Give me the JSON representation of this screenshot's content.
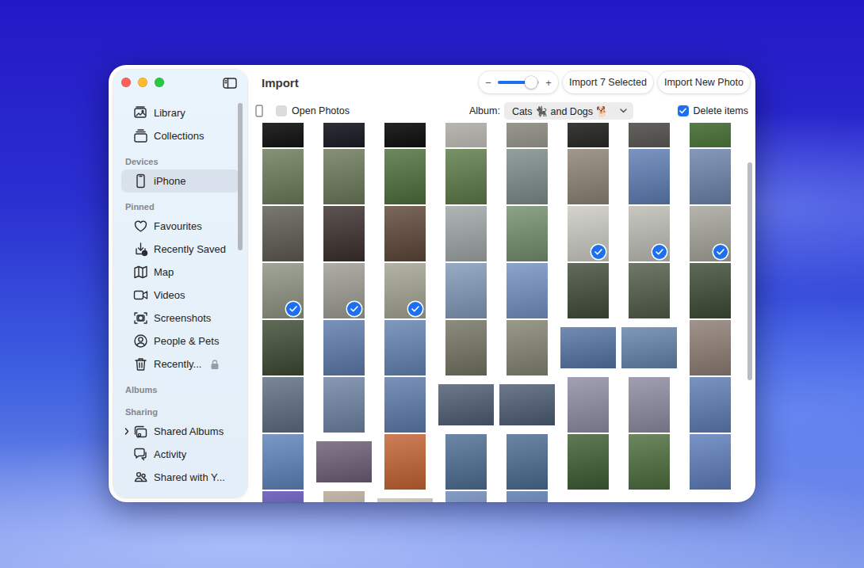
{
  "window": {
    "title": "Import"
  },
  "sidebar": {
    "sections": [
      {
        "items": [
          {
            "label": "Library",
            "selected": false,
            "locked": false,
            "kind": "item"
          },
          {
            "label": "Collections",
            "selected": false,
            "locked": false,
            "kind": "item"
          }
        ]
      },
      {
        "header": "Devices",
        "items": [
          {
            "label": "iPhone",
            "selected": true,
            "locked": false,
            "kind": "item"
          }
        ]
      },
      {
        "header": "Pinned",
        "items": [
          {
            "label": "Favourites",
            "selected": false,
            "locked": false,
            "kind": "item"
          },
          {
            "label": "Recently Saved",
            "selected": false,
            "locked": false,
            "kind": "item"
          },
          {
            "label": "Map",
            "selected": false,
            "locked": false,
            "kind": "item"
          },
          {
            "label": "Videos",
            "selected": false,
            "locked": false,
            "kind": "item"
          },
          {
            "label": "Screenshots",
            "selected": false,
            "locked": false,
            "kind": "item"
          },
          {
            "label": "People & Pets",
            "selected": false,
            "locked": false,
            "kind": "item"
          },
          {
            "label": "Recently...",
            "selected": false,
            "locked": true,
            "kind": "item"
          }
        ]
      },
      {
        "header": "Albums",
        "items": []
      },
      {
        "header": "Sharing",
        "items": [
          {
            "label": "Shared Albums",
            "selected": false,
            "locked": false,
            "kind": "group",
            "expanded": false
          },
          {
            "label": "Activity",
            "selected": false,
            "locked": false,
            "kind": "item"
          },
          {
            "label": "Shared with Y...",
            "selected": false,
            "locked": false,
            "kind": "item"
          }
        ]
      }
    ]
  },
  "toolbar": {
    "zoom": {
      "minus": "−",
      "plus": "+",
      "level": 0.8
    },
    "buttons": [
      {
        "label": "Import 7 Selected"
      },
      {
        "label": "Import New Photo"
      }
    ],
    "open_photos": {
      "label": "Open Photos",
      "checked": false
    },
    "album": {
      "label": "Album:",
      "value": "Cats 🐈‍⬛ and Dogs 🐕"
    },
    "delete_items": {
      "label": "Delete items",
      "checked": true
    }
  },
  "photos": {
    "rows": [
      [
        {
          "kind": "portrait",
          "color": "#141414",
          "selected": false
        },
        {
          "kind": "portrait",
          "color": "#1c1c26",
          "selected": false
        },
        {
          "kind": "portrait",
          "color": "#101010",
          "selected": false
        },
        {
          "kind": "portrait",
          "color": "#c4c2bc",
          "selected": false
        },
        {
          "kind": "portrait",
          "color": "#9c9c90",
          "selected": false
        },
        {
          "kind": "portrait",
          "color": "#2a2a28",
          "selected": false
        },
        {
          "kind": "portrait",
          "color": "#5c5a56",
          "selected": false
        },
        {
          "kind": "portrait",
          "color": "#4f7a3c",
          "selected": false
        }
      ],
      [
        {
          "kind": "portrait",
          "color": "#6b7a58",
          "selected": false
        },
        {
          "kind": "portrait",
          "color": "#6a7858",
          "selected": false
        },
        {
          "kind": "portrait",
          "color": "#4d6e3a",
          "selected": false
        },
        {
          "kind": "portrait",
          "color": "#5b7a46",
          "selected": false
        },
        {
          "kind": "portrait",
          "color": "#7c8a88",
          "selected": false
        },
        {
          "kind": "portrait",
          "color": "#8a8272",
          "selected": false
        },
        {
          "kind": "portrait",
          "color": "#5d7cb2",
          "selected": false
        },
        {
          "kind": "portrait",
          "color": "#6a82aa",
          "selected": false
        }
      ],
      [
        {
          "kind": "portrait",
          "color": "#5c5a50",
          "selected": false
        },
        {
          "kind": "portrait",
          "color": "#3a2e2c",
          "selected": false
        },
        {
          "kind": "portrait",
          "color": "#5c4638",
          "selected": false
        },
        {
          "kind": "portrait",
          "color": "#9ea4a4",
          "selected": false
        },
        {
          "kind": "portrait",
          "color": "#728e6c",
          "selected": false
        },
        {
          "kind": "portrait",
          "color": "#cacac2",
          "selected": true
        },
        {
          "kind": "portrait",
          "color": "#bcbcb4",
          "selected": true
        },
        {
          "kind": "portrait",
          "color": "#a4a49a",
          "selected": true
        }
      ],
      [
        {
          "kind": "portrait",
          "color": "#8c9282",
          "selected": true
        },
        {
          "kind": "portrait",
          "color": "#9c9c92",
          "selected": true
        },
        {
          "kind": "portrait",
          "color": "#a2a292",
          "selected": true
        },
        {
          "kind": "portrait",
          "color": "#8098b8",
          "selected": false
        },
        {
          "kind": "portrait",
          "color": "#7290c0",
          "selected": false
        },
        {
          "kind": "portrait",
          "color": "#404a38",
          "selected": false
        },
        {
          "kind": "portrait",
          "color": "#505a48",
          "selected": false
        },
        {
          "kind": "portrait",
          "color": "#3c4a32",
          "selected": false
        }
      ],
      [
        {
          "kind": "portrait",
          "color": "#3c4a32",
          "selected": false
        },
        {
          "kind": "portrait",
          "color": "#5c7aaa",
          "selected": false
        },
        {
          "kind": "portrait",
          "color": "#6282b2",
          "selected": false
        },
        {
          "kind": "portrait",
          "color": "#727262",
          "selected": false
        },
        {
          "kind": "portrait",
          "color": "#828272",
          "selected": false
        },
        {
          "kind": "landscape",
          "color": "#5272a2",
          "selected": false
        },
        {
          "kind": "landscape",
          "color": "#6282aa",
          "selected": false
        },
        {
          "kind": "portrait",
          "color": "#8c7c72",
          "selected": false
        }
      ],
      [
        {
          "kind": "portrait",
          "color": "#5c6c82",
          "selected": false
        },
        {
          "kind": "portrait",
          "color": "#6c82a2",
          "selected": false
        },
        {
          "kind": "portrait",
          "color": "#5c7aaa",
          "selected": false
        },
        {
          "kind": "landscape",
          "color": "#4c5c72",
          "selected": false
        },
        {
          "kind": "landscape",
          "color": "#4c5c74",
          "selected": false
        },
        {
          "kind": "portrait",
          "color": "#8c8ca2",
          "selected": false
        },
        {
          "kind": "portrait",
          "color": "#8a8aa0",
          "selected": false
        },
        {
          "kind": "portrait",
          "color": "#5c7cb2",
          "selected": false
        }
      ],
      [
        {
          "kind": "portrait",
          "color": "#5c82ba",
          "selected": false
        },
        {
          "kind": "landscape",
          "color": "#6c5c72",
          "selected": false
        },
        {
          "kind": "portrait",
          "color": "#c26232",
          "selected": false
        },
        {
          "kind": "portrait",
          "color": "#4c6c92",
          "selected": false
        },
        {
          "kind": "portrait",
          "color": "#4a6a90",
          "selected": false
        },
        {
          "kind": "portrait",
          "color": "#3c5c32",
          "selected": false
        },
        {
          "kind": "portrait",
          "color": "#4c6c3c",
          "selected": false
        },
        {
          "kind": "portrait",
          "color": "#5c7cba",
          "selected": false
        }
      ],
      [
        {
          "kind": "portrait",
          "color": "#5a4cb2",
          "selected": false
        },
        {
          "kind": "portrait",
          "color": "#b4a694",
          "selected": false
        },
        {
          "kind": "landscape",
          "color": "#c8c0b4",
          "selected": false
        },
        {
          "kind": "portrait",
          "color": "#6a86b8",
          "selected": false
        },
        {
          "kind": "portrait",
          "color": "#5878b0",
          "selected": false
        }
      ]
    ]
  }
}
